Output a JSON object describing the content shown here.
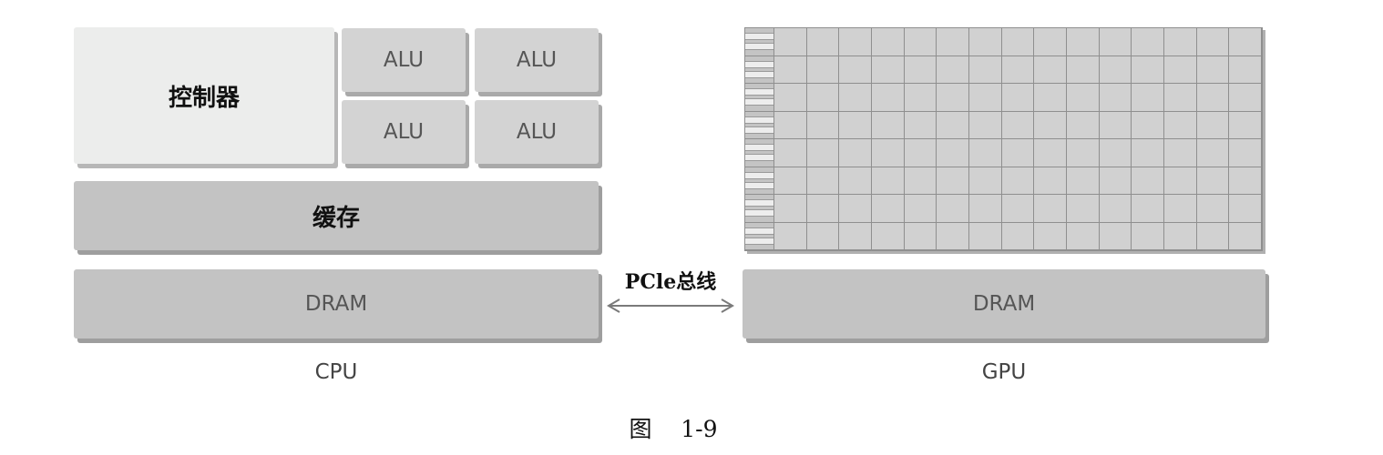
{
  "cpu": {
    "controller_label": "控制器",
    "alu_labels": [
      "ALU",
      "ALU",
      "ALU",
      "ALU"
    ],
    "cache_label": "缓存",
    "dram_label": "DRAM",
    "caption": "CPU"
  },
  "bus": {
    "label": "PCle总线"
  },
  "gpu": {
    "grid_columns": 15,
    "grid_rows": 8,
    "dram_label": "DRAM",
    "caption": "GPU"
  },
  "figure": {
    "caption": "图    1-9"
  }
}
